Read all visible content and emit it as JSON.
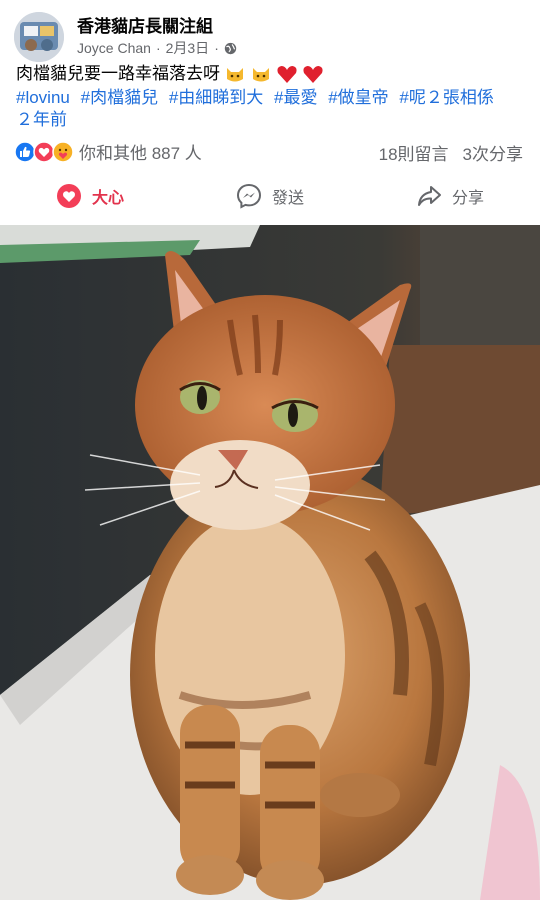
{
  "post": {
    "group_name": "香港貓店長關注組",
    "author": "Joyce Chan",
    "date": "2月3日",
    "separator": "·",
    "text": "肉檔貓兒要一路幸福落去呀",
    "emojis": [
      "cat-face-icon",
      "cat-face-icon",
      "red-heart-icon",
      "red-heart-icon"
    ],
    "hashtags": [
      "#lovinu",
      "#肉檔貓兒",
      "#由細睇到大",
      "#最愛",
      "#做皇帝",
      "#呢２張相係"
    ],
    "time_ago": "２年前"
  },
  "reactions": {
    "icons": [
      "like-icon",
      "love-icon",
      "care-icon"
    ],
    "summary": "你和其他 887 人",
    "comments": "18則留言",
    "shares": "3次分享"
  },
  "actions": {
    "love_label": "大心",
    "send_label": "發送",
    "share_label": "分享"
  },
  "colors": {
    "accent_blue": "#216fdb",
    "love_red": "#e2334d",
    "secondary_text": "#65676b"
  },
  "photo": {
    "description_icon": "tabby-cat-photo"
  }
}
